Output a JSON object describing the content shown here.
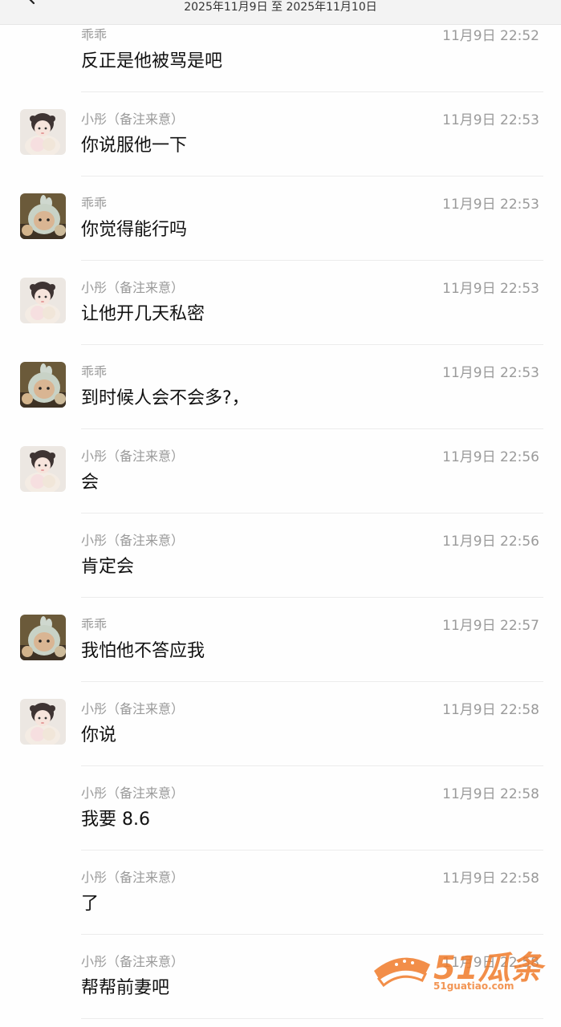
{
  "header": {
    "date_range": "2025年11月9日 至 2025年11月10日"
  },
  "icons": {
    "back": "chevron-left-icon",
    "avatar_girl": "girl-avatar",
    "avatar_toy": "toy-avatar"
  },
  "messages": [
    {
      "sender": "乖乖",
      "time": "11月9日 22:52",
      "text": "反正是他被骂是吧",
      "avatar": "none"
    },
    {
      "sender": "小彤（备注来意）",
      "time": "11月9日 22:53",
      "text": "你说服他一下",
      "avatar": "girl"
    },
    {
      "sender": "乖乖",
      "time": "11月9日 22:53",
      "text": "你觉得能行吗",
      "avatar": "toy"
    },
    {
      "sender": "小彤（备注来意）",
      "time": "11月9日 22:53",
      "text": "让他开几天私密",
      "avatar": "girl"
    },
    {
      "sender": "乖乖",
      "time": "11月9日 22:53",
      "text": "到时候人会不会多?，",
      "avatar": "toy"
    },
    {
      "sender": "小彤（备注来意）",
      "time": "11月9日 22:56",
      "text": "会",
      "avatar": "girl"
    },
    {
      "sender": "小彤（备注来意）",
      "time": "11月9日 22:56",
      "text": "肯定会",
      "avatar": "none"
    },
    {
      "sender": "乖乖",
      "time": "11月9日 22:57",
      "text": "我怕他不答应我",
      "avatar": "toy"
    },
    {
      "sender": "小彤（备注来意）",
      "time": "11月9日 22:58",
      "text": "你说",
      "avatar": "girl"
    },
    {
      "sender": "小彤（备注来意）",
      "time": "11月9日 22:58",
      "text": "我要 8.6",
      "avatar": "none"
    },
    {
      "sender": "小彤（备注来意）",
      "time": "11月9日 22:58",
      "text": "了",
      "avatar": "none"
    },
    {
      "sender": "小彤（备注来意）",
      "time": "11月9日 22:58",
      "text": "帮帮前妻吧",
      "avatar": "none"
    }
  ],
  "watermark": {
    "brand": "51瓜条",
    "url": "51guatiao.com"
  },
  "colors": {
    "watermark": "#f07b2a",
    "meta_text": "#9a9a9a",
    "body_text": "#111111"
  }
}
